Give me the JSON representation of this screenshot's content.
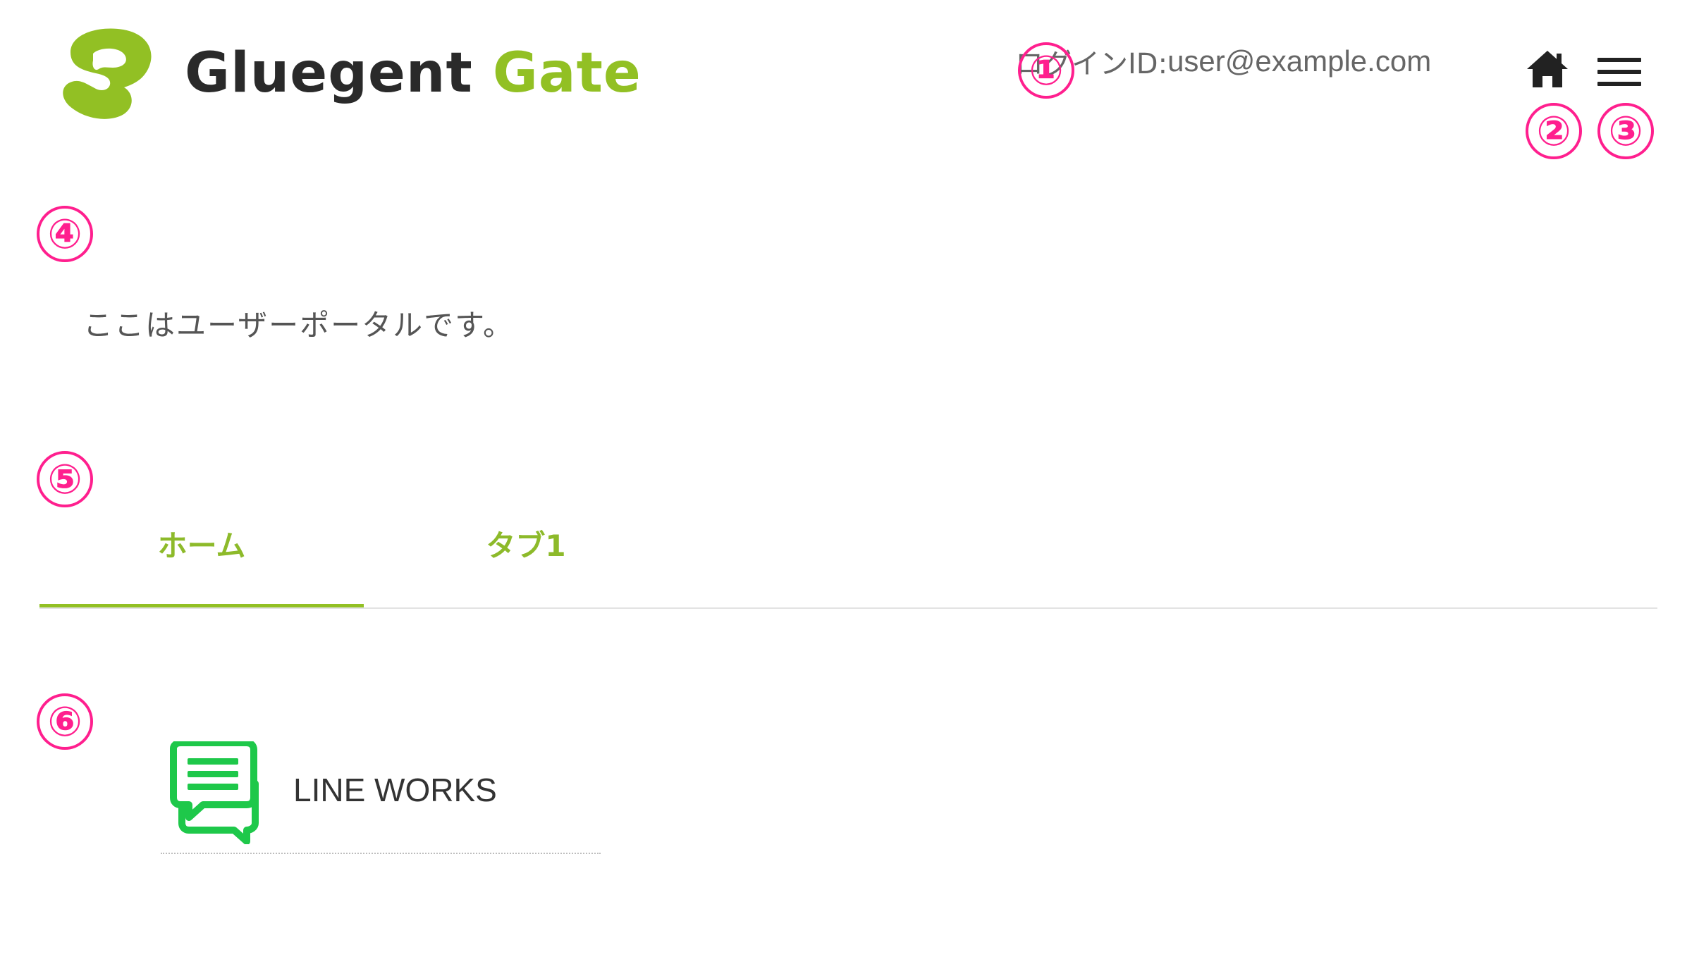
{
  "header": {
    "logo": {
      "word1": "Gluegent",
      "word2": "Gate",
      "brand_color": "#92c024"
    },
    "login_id_prefix": "ログインID: ",
    "login_id": "user@example.com",
    "home_icon": "home-icon",
    "menu_icon": "hamburger-menu-icon"
  },
  "annotations": [
    "①",
    "②",
    "③",
    "④",
    "⑤",
    "⑥"
  ],
  "annotation_color": "#ff1f8e",
  "portal": {
    "message": "ここはユーザーポータルです。"
  },
  "tabs": [
    {
      "label": "ホーム",
      "active": true
    },
    {
      "label": "タブ1",
      "active": false
    }
  ],
  "tab_accent_color": "#92c024",
  "apps": [
    {
      "label": "LINE WORKS",
      "icon": "chat-bubbles-icon",
      "icon_color": "#1ec84a"
    }
  ]
}
